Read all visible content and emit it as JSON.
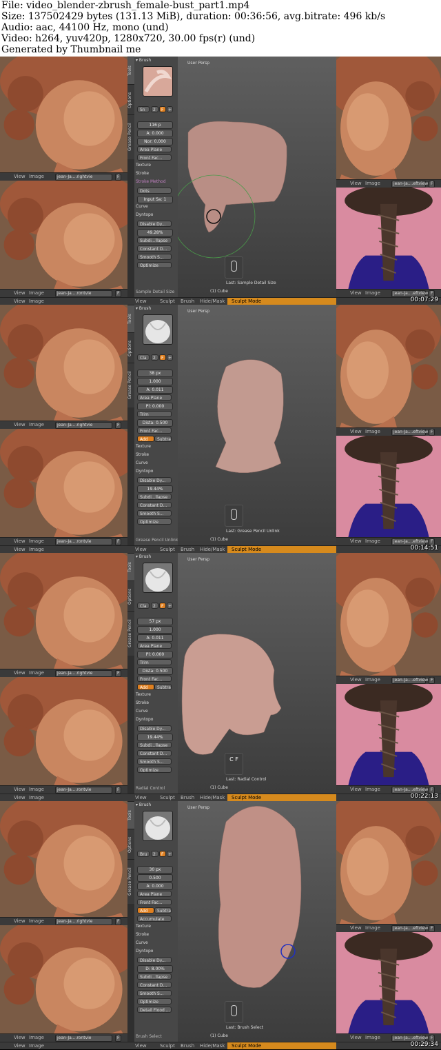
{
  "header": {
    "file": "File: video_blender-zbrush_female-bust_part1.mp4",
    "size": "Size: 137502429 bytes (131.13 MiB), duration: 00:36:56, avg.bitrate: 496 kb/s",
    "audio": "Audio: aac, 44100 Hz, mono (und)",
    "video": "Video: h264, yuv420p, 1280x720, 30.00 fps(r) (und)",
    "generator": "Generated by Thumbnail me"
  },
  "common": {
    "view": "View",
    "image": "Image",
    "ref_right": "jean-Ja....rightvie",
    "ref_front": "jean-Ja....rontvie",
    "ref_left": "jean-Ja....eftview",
    "f": "F",
    "tools_tab": "Tools",
    "options_tab": "Options",
    "grease_tab": "Grease Pencil",
    "user_persp": "User Persp",
    "cube": "(1) Cube",
    "sculpt_mode": "Sculpt Mode",
    "bottom_menus": [
      "View",
      "Sculpt",
      "Brush",
      "Hide/Mask"
    ],
    "accent_color": "#e08020"
  },
  "frames": [
    {
      "timestamp": "00:07:29",
      "brush": "Sn",
      "brush_num": "2",
      "radius": "116 p",
      "strength": "A: 0.000",
      "extra": "Nor: 0.000",
      "plane": "Area Plane",
      "front": "Front Fac...",
      "texture": "Texture",
      "stroke": "Stroke",
      "stroke_method": "Stroke Method",
      "dots": "Dots",
      "input": "Input Sa: 1",
      "curve": "Curve",
      "dyntopo": "Dyntopo",
      "disable": "Disable Dy...",
      "pct": "49.28%",
      "subdiv": "Subdi...llapse",
      "constant": "Constant D...",
      "smooth": "Smooth S...",
      "optimize": "Optimize",
      "footer": "Sample Detail Size",
      "last": "Last: Sample Detail Size"
    },
    {
      "timestamp": "00:14:51",
      "brush": "Cla",
      "brush_num": "2",
      "radius": "38 px",
      "strength": "1.000",
      "extra": "A: 0.011",
      "plane": "Area Plane",
      "plane2": "Pl: 0.000",
      "trim": "Trim",
      "dist": "Dista: 0.500",
      "front": "Front Fac...",
      "add": "Add",
      "subtract": "Subtrac",
      "texture": "Texture",
      "stroke": "Stroke",
      "curve": "Curve",
      "dyntopo": "Dyntopo",
      "disable": "Disable Dy...",
      "pct": "19.44%",
      "subdiv": "Subdi...llapse",
      "constant": "Constant D...",
      "smooth": "Smooth S...",
      "optimize": "Optimize",
      "footer": "Grease Pencil Unlink",
      "last": "Last: Grease Pencil Unlink"
    },
    {
      "timestamp": "00:22:13",
      "brush": "Cla",
      "brush_num": "2",
      "radius": "57 px",
      "strength": "1.000",
      "extra": "A: 0.011",
      "plane": "Area Plane",
      "plane2": "Pl: 0.000",
      "trim": "Trim",
      "dist": "Dista: 0.500",
      "front": "Front Fac...",
      "add": "Add",
      "subtract": "Subtrac",
      "texture": "Texture",
      "stroke": "Stroke",
      "curve": "Curve",
      "dyntopo": "Dyntopo",
      "disable": "Disable Dy...",
      "pct": "19.44%",
      "subdiv": "Subdi...llapse",
      "constant": "Constant D...",
      "smooth": "Smooth S...",
      "optimize": "Optimize",
      "footer": "Radial Control",
      "last": "Last: Radial Control",
      "keys": "C F"
    },
    {
      "timestamp": "00:29:34",
      "brush": "Bru",
      "brush_num": "2",
      "radius": "30 px",
      "strength": "0.500",
      "extra": "A: 0.000",
      "plane": "Area Plane",
      "front": "Front Fac...",
      "add": "Add",
      "subtract": "Subtrac",
      "accumulate": "Accumulate",
      "texture": "Texture",
      "stroke": "Stroke",
      "curve": "Curve",
      "dyntopo": "Dyntopo",
      "disable": "Disable Dy...",
      "pct": "D: 8.00%",
      "subdiv": "Subdi...llapse",
      "constant": "Constant D...",
      "smooth": "Smooth S...",
      "optimize": "Optimize",
      "detail": "Detail Flood ...",
      "footer": "Brush Select",
      "last": "Last: Brush Select"
    }
  ]
}
